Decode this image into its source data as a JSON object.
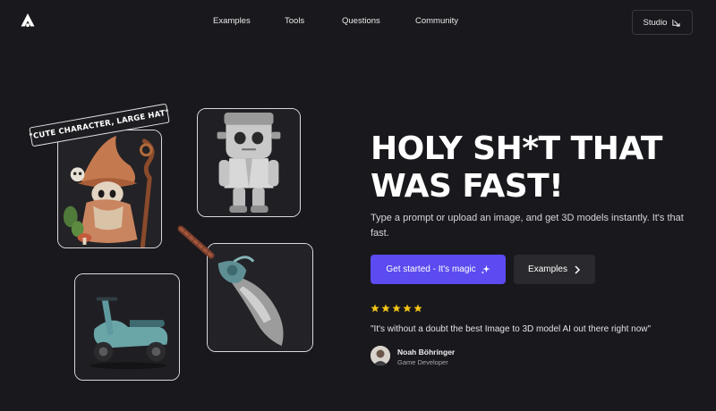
{
  "nav": {
    "links": [
      "Examples",
      "Tools",
      "Questions",
      "Community"
    ],
    "studio_label": "Studio"
  },
  "showcase": {
    "prompt_tag": "\"CUTE CHARACTER, LARGE HAT\"",
    "cards": [
      "wizard-character",
      "frankenstein-figure",
      "scooter",
      "ornate-sword"
    ]
  },
  "hero": {
    "title_line1": "HOLY SH*T THAT",
    "title_line2": "WAS FAST!",
    "subtitle": "Type a prompt or upload an image, and get 3D models instantly. It's that fast.",
    "primary_cta": "Get started - It's magic",
    "secondary_cta": "Examples"
  },
  "testimonial": {
    "rating": 5,
    "quote": "\"It's without a doubt the best Image to 3D model AI out there right now\"",
    "name": "Noah Böhringer",
    "role": "Game Developer"
  },
  "colors": {
    "background": "#19181c",
    "accent": "#5b4bf0",
    "star": "#f5c518"
  }
}
